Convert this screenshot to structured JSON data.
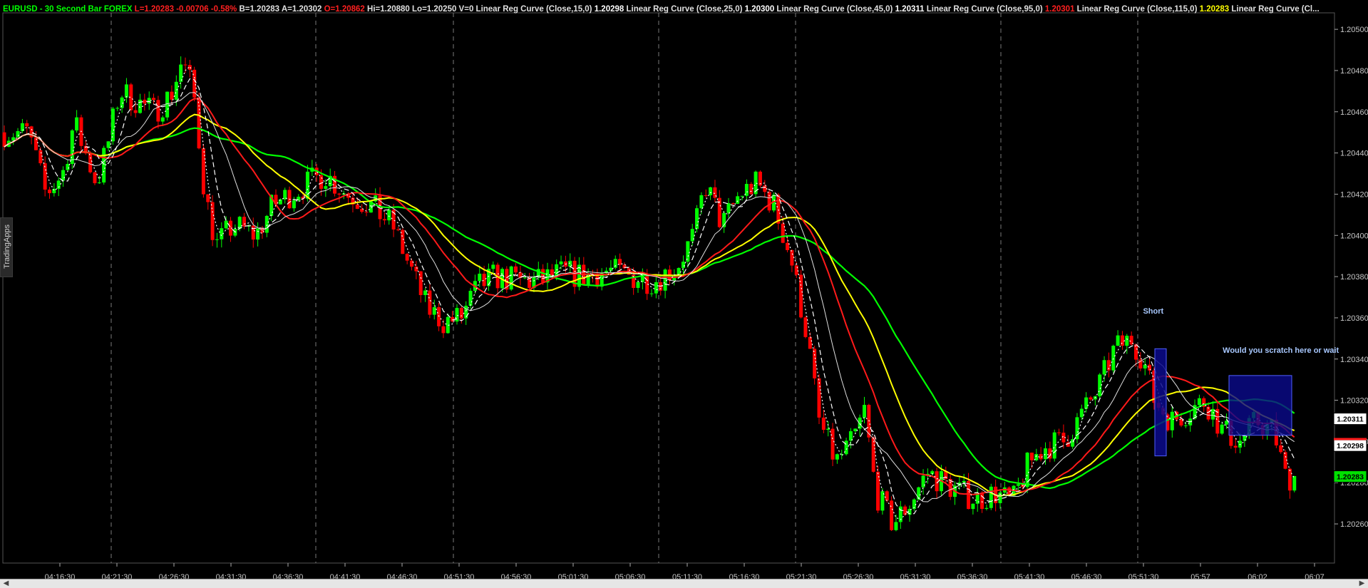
{
  "header": {
    "symbol": "EURUSD - 30 Second Bar  FOREX",
    "last": "L=1.20283",
    "change": "-0.00706",
    "change_pct": "-0.58%",
    "bid": "B=1.20283",
    "ask": "A=1.20302",
    "open": "O=1.20862",
    "high": "Hi=1.20880",
    "low": "Lo=1.20250",
    "volume": "V=0",
    "indicators": [
      {
        "label": "Linear Reg Curve (Close,15,0)",
        "value": "1.20298",
        "color": "#ffffff"
      },
      {
        "label": "Linear Reg Curve (Close,25,0)",
        "value": "1.20300",
        "color": "#ffffff"
      },
      {
        "label": "Linear Reg Curve (Close,45,0)",
        "value": "1.20311",
        "color": "#ffffff"
      },
      {
        "label": "Linear Reg Curve (Close,95,0)",
        "value": "1.20301",
        "color": "#ff2020"
      },
      {
        "label": "Linear Reg Curve (Close,115,0)",
        "value": "1.20283",
        "color": "#ffff00"
      },
      {
        "label": "Linear Reg Curve (Cl...",
        "value": "",
        "color": "#ffffff"
      }
    ]
  },
  "side_tab": {
    "label": "TradingApps"
  },
  "colors": {
    "background": "#000000",
    "up_candle": "#00ff00",
    "down_candle": "#ff0000",
    "lr15": "#ffffff",
    "lr25": "#ffffff",
    "lr45": "#e0e0e0",
    "lr95": "#ff1a1a",
    "lr115": "#ffff00",
    "lr_long": "#00ff00",
    "box": "#0a0a8c"
  },
  "annotations": [
    {
      "text": "Short",
      "x": "05:52",
      "y": 1.20362
    },
    {
      "text": "Would you scratch here or wait",
      "x": "05:59",
      "y": 1.20343
    }
  ],
  "price_tags": [
    {
      "text": "1.20311",
      "y": 1.20311,
      "bg": "#ffffff",
      "fg": "#000000"
    },
    {
      "text": "1.20298",
      "y": 1.20298,
      "bg": "#ffffff",
      "fg": "#000000"
    },
    {
      "text": "1.20283",
      "y": 1.20283,
      "bg": "#00e000",
      "fg": "#000000"
    }
  ],
  "chart_data": {
    "type": "line",
    "subtype": "candlestick",
    "title": "EURUSD - 30 Second Bar  FOREX",
    "x_ticks": [
      "04:16:30",
      "04:21:30",
      "04:26:30",
      "04:31:30",
      "04:36:30",
      "04:41:30",
      "04:46:30",
      "04:51:30",
      "04:56:30",
      "05:01:30",
      "05:06:30",
      "05:11:30",
      "05:16:30",
      "05:21:30",
      "05:26:30",
      "05:31:30",
      "05:36:30",
      "05:41:30",
      "05:46:30",
      "05:51:30",
      "05:57",
      "06:02",
      "06:07"
    ],
    "y_ticks": [
      "1.20500",
      "1.20480",
      "1.20460",
      "1.20440",
      "1.20420",
      "1.20400",
      "1.20380",
      "1.20360",
      "1.20340",
      "1.20320",
      "1.20300",
      "1.20280",
      "1.20260"
    ],
    "ylim": [
      1.20241,
      1.20508
    ],
    "grid": "vertical dashed session lines",
    "series": [
      {
        "name": "Linear Reg Curve (Close,15,0)",
        "style": "dotted",
        "last": 1.20298
      },
      {
        "name": "Linear Reg Curve (Close,25,0)",
        "style": "dashed",
        "last": 1.203
      },
      {
        "name": "Linear Reg Curve (Close,45,0)",
        "style": "solid",
        "last": 1.20311
      },
      {
        "name": "Linear Reg Curve (Close,95,0)",
        "style": "solid",
        "last": 1.20301
      },
      {
        "name": "Linear Reg Curve (Close,115,0)",
        "style": "solid",
        "last": 1.20283
      }
    ],
    "price_path": [
      [
        "04:14:00",
        1.2045
      ],
      [
        "04:15:30",
        1.2042
      ],
      [
        "04:17:00",
        1.2043
      ],
      [
        "04:18:00",
        1.20455
      ],
      [
        "04:19:00",
        1.2044
      ],
      [
        "04:20:00",
        1.20425
      ],
      [
        "04:21:00",
        1.20445
      ],
      [
        "04:22:00",
        1.2047
      ],
      [
        "04:23:30",
        1.20465
      ],
      [
        "04:25:00",
        1.2046
      ],
      [
        "04:26:30",
        1.20468
      ],
      [
        "04:27:30",
        1.20485
      ],
      [
        "04:28:30",
        1.2047
      ],
      [
        "04:29:30",
        1.2042
      ],
      [
        "04:30:30",
        1.20395
      ],
      [
        "04:32:00",
        1.20405
      ],
      [
        "04:34:00",
        1.204
      ],
      [
        "04:35:30",
        1.20415
      ],
      [
        "04:37:00",
        1.2042
      ],
      [
        "04:38:30",
        1.20425
      ],
      [
        "04:40:00",
        1.2043
      ],
      [
        "04:42:00",
        1.2042
      ],
      [
        "04:44:00",
        1.20415
      ],
      [
        "04:46:00",
        1.20405
      ],
      [
        "04:47:30",
        1.20385
      ],
      [
        "04:49:00",
        1.20365
      ],
      [
        "04:50:30",
        1.20358
      ],
      [
        "04:52:00",
        1.2036
      ],
      [
        "04:53:30",
        1.20375
      ],
      [
        "04:55:00",
        1.2038
      ],
      [
        "04:57:00",
        1.20378
      ],
      [
        "04:59:00",
        1.20378
      ],
      [
        "05:01:00",
        1.20382
      ],
      [
        "05:03:00",
        1.2038
      ],
      [
        "05:05:00",
        1.20383
      ],
      [
        "05:07:00",
        1.2038
      ],
      [
        "05:09:00",
        1.20378
      ],
      [
        "05:11:00",
        1.20385
      ],
      [
        "05:12:30",
        1.204
      ],
      [
        "05:13:30",
        1.20425
      ],
      [
        "05:15:00",
        1.20405
      ],
      [
        "05:16:30",
        1.2042
      ],
      [
        "05:18:00",
        1.20425
      ],
      [
        "05:19:30",
        1.20415
      ],
      [
        "05:21:00",
        1.2039
      ],
      [
        "05:22:30",
        1.2035
      ],
      [
        "05:23:30",
        1.2031
      ],
      [
        "05:25:00",
        1.2029
      ],
      [
        "05:26:30",
        1.203
      ],
      [
        "05:27:30",
        1.20315
      ],
      [
        "05:28:30",
        1.20275
      ],
      [
        "05:30:00",
        1.2026
      ],
      [
        "05:31:30",
        1.2027
      ],
      [
        "05:33:00",
        1.20285
      ],
      [
        "05:34:30",
        1.2028
      ],
      [
        "05:36:00",
        1.20275
      ],
      [
        "05:37:30",
        1.20272
      ],
      [
        "05:39:00",
        1.20275
      ],
      [
        "05:40:30",
        1.2027
      ],
      [
        "05:42:00",
        1.2029
      ],
      [
        "05:43:30",
        1.20298
      ],
      [
        "05:45:00",
        1.203
      ],
      [
        "05:46:30",
        1.20312
      ],
      [
        "05:48:00",
        1.20325
      ],
      [
        "05:49:30",
        1.20345
      ],
      [
        "05:51:00",
        1.2035
      ],
      [
        "05:52:00",
        1.2034
      ],
      [
        "05:53:00",
        1.2032
      ],
      [
        "05:54:30",
        1.2031
      ],
      [
        "05:56:00",
        1.20315
      ],
      [
        "05:57:30",
        1.2032
      ],
      [
        "05:59:00",
        1.20305
      ],
      [
        "06:00:30",
        1.203
      ],
      [
        "06:02:00",
        1.2031
      ],
      [
        "06:03:30",
        1.20305
      ],
      [
        "06:04:30",
        1.20283
      ]
    ]
  }
}
